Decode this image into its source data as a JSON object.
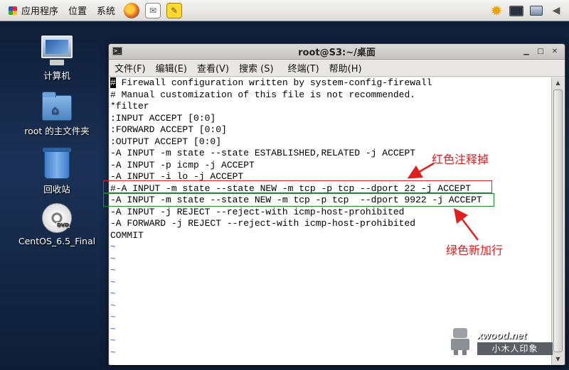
{
  "top_panel": {
    "menus": [
      "应用程序",
      "位置",
      "系统"
    ]
  },
  "desktop": {
    "icons": [
      {
        "label": "计算机",
        "icon": "computer-icon"
      },
      {
        "label": "root 的主文件夹",
        "icon": "home-folder-icon"
      },
      {
        "label": "回收站",
        "icon": "trash-icon"
      },
      {
        "label": "CentOS_6.5_Final",
        "icon": "dvd-icon"
      }
    ]
  },
  "terminal": {
    "title": "root@S3:~/桌面",
    "menu": [
      "文件(F)",
      "编辑(E)",
      "查看(V)",
      "搜索 (S)",
      "终端(T)",
      "帮助(H)"
    ],
    "lines": [
      " Firewall configuration written by system-config-firewall",
      "# Manual customization of this file is not recommended.",
      "*filter",
      ":INPUT ACCEPT [0:0]",
      ":FORWARD ACCEPT [0:0]",
      ":OUTPUT ACCEPT [0:0]",
      "-A INPUT -m state --state ESTABLISHED,RELATED -j ACCEPT",
      "-A INPUT -p icmp -j ACCEPT",
      "-A INPUT -i lo -j ACCEPT",
      "#-A INPUT -m state --state NEW -m tcp -p tcp --dport 22 -j ACCEPT",
      "-A INPUT -m state --state NEW -m tcp -p tcp  --dport 9922 -j ACCEPT",
      "-A INPUT -j REJECT --reject-with icmp-host-prohibited",
      "-A FORWARD -j REJECT --reject-with icmp-host-prohibited",
      "COMMIT"
    ],
    "first_char": "#",
    "tilde_lines": [
      "~",
      "~",
      "~",
      "~",
      "~",
      "~",
      "~",
      "~",
      "~",
      "~"
    ]
  },
  "annotations": {
    "red_label": "红色注释掉",
    "green_label": "绿色新加行",
    "colors": {
      "red": "#e02020",
      "green": "#1a8a2a"
    }
  },
  "watermark": {
    "logo": "xwood.net",
    "tagline": "小木人印象"
  }
}
